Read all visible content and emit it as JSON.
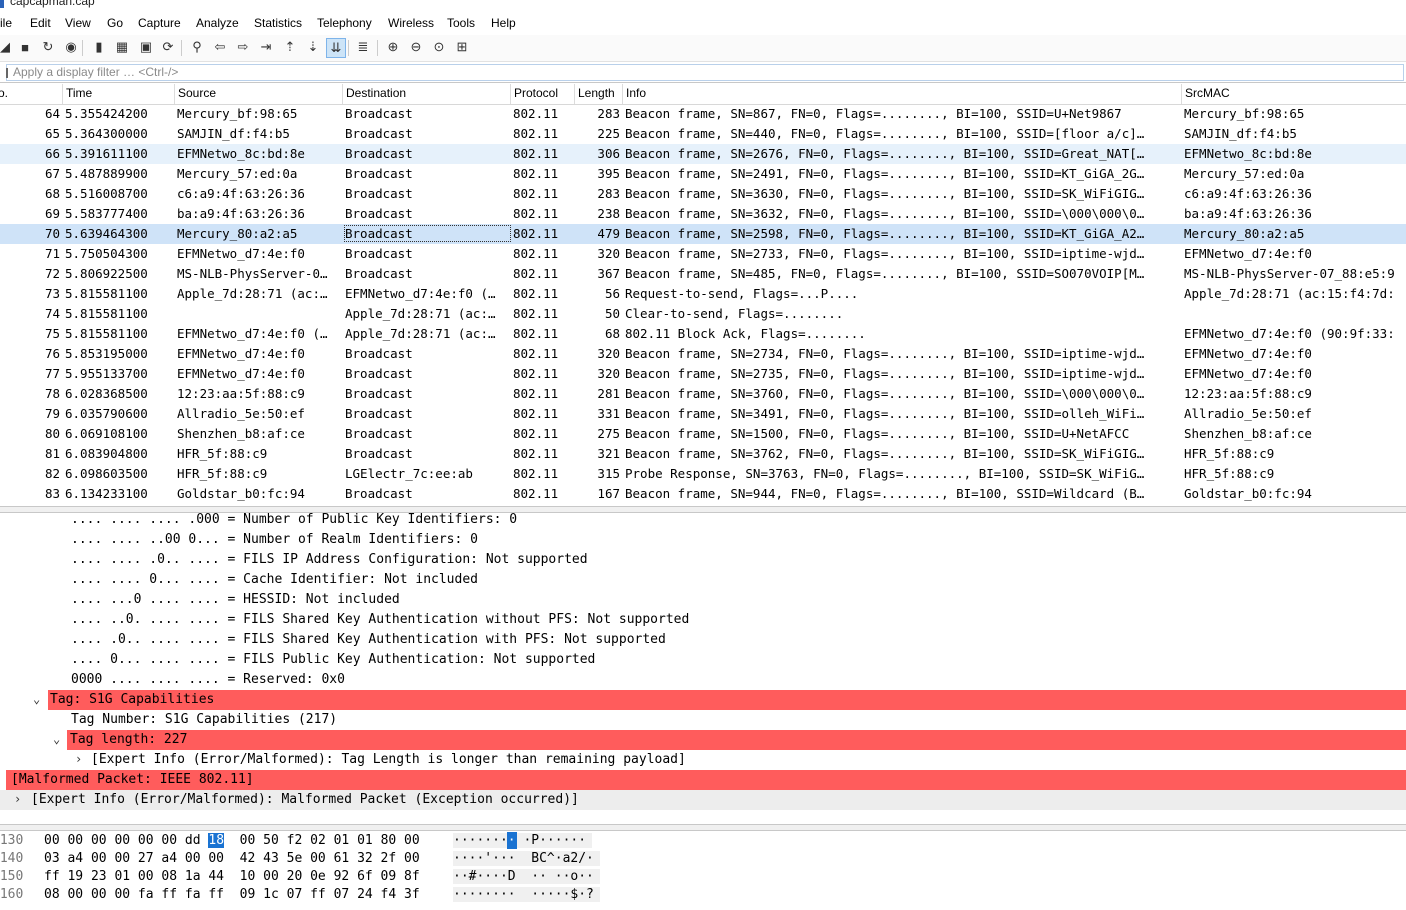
{
  "window": {
    "title": "capcapman.cap"
  },
  "menu": [
    "ile",
    "Edit",
    "View",
    "Go",
    "Capture",
    "Analyze",
    "Statistics",
    "Telephony",
    "Wireless",
    "Tools",
    "Help"
  ],
  "toolbar_icons": [
    "shark-fin-icon",
    "stop-icon",
    "restart-icon",
    "options-icon",
    "open-file-icon",
    "save-icon",
    "close-file-icon",
    "reload-icon",
    "find-icon",
    "back-icon",
    "forward-icon",
    "goto-packet-icon",
    "first-packet-icon",
    "last-packet-icon",
    "autoscroll-icon",
    "colorize-icon",
    "zoom-in-icon",
    "zoom-out-icon",
    "normal-size-icon",
    "resize-columns-icon"
  ],
  "filter": {
    "placeholder": "Apply a display filter … <Ctrl-/>"
  },
  "columns": [
    "o.",
    "Time",
    "Source",
    "Destination",
    "Protocol",
    "Length",
    "Info",
    "SrcMAC"
  ],
  "packets": [
    {
      "no": "64",
      "time": "5.355424200",
      "src": "Mercury_bf:98:65",
      "dst": "Broadcast",
      "proto": "802.11",
      "len": "283",
      "info": "Beacon frame, SN=867, FN=0, Flags=........, BI=100, SSID=U+Net9867",
      "srcmac": "Mercury_bf:98:65"
    },
    {
      "no": "65",
      "time": "5.364300000",
      "src": "SAMJIN_df:f4:b5",
      "dst": "Broadcast",
      "proto": "802.11",
      "len": "225",
      "info": "Beacon frame, SN=440, FN=0, Flags=........, BI=100, SSID=[floor a/c]…",
      "srcmac": "SAMJIN_df:f4:b5"
    },
    {
      "no": "66",
      "time": "5.391611100",
      "src": "EFMNetwo_8c:bd:8e",
      "dst": "Broadcast",
      "proto": "802.11",
      "len": "306",
      "info": "Beacon frame, SN=2676, FN=0, Flags=........, BI=100, SSID=Great_NAT[…",
      "srcmac": "EFMNetwo_8c:bd:8e"
    },
    {
      "no": "67",
      "time": "5.487889900",
      "src": "Mercury_57:ed:0a",
      "dst": "Broadcast",
      "proto": "802.11",
      "len": "395",
      "info": "Beacon frame, SN=2491, FN=0, Flags=........, BI=100, SSID=KT_GiGA_2G…",
      "srcmac": "Mercury_57:ed:0a"
    },
    {
      "no": "68",
      "time": "5.516008700",
      "src": "c6:a9:4f:63:26:36",
      "dst": "Broadcast",
      "proto": "802.11",
      "len": "283",
      "info": "Beacon frame, SN=3630, FN=0, Flags=........, BI=100, SSID=SK_WiFiGIG…",
      "srcmac": "c6:a9:4f:63:26:36"
    },
    {
      "no": "69",
      "time": "5.583777400",
      "src": "ba:a9:4f:63:26:36",
      "dst": "Broadcast",
      "proto": "802.11",
      "len": "238",
      "info": "Beacon frame, SN=3632, FN=0, Flags=........, BI=100, SSID=\\000\\000\\0…",
      "srcmac": "ba:a9:4f:63:26:36"
    },
    {
      "no": "70",
      "time": "5.639464300",
      "src": "Mercury_80:a2:a5",
      "dst": "Broadcast",
      "proto": "802.11",
      "len": "479",
      "info": "Beacon frame, SN=2598, FN=0, Flags=........, BI=100, SSID=KT_GiGA_A2…",
      "srcmac": "Mercury_80:a2:a5"
    },
    {
      "no": "71",
      "time": "5.750504300",
      "src": "EFMNetwo_d7:4e:f0",
      "dst": "Broadcast",
      "proto": "802.11",
      "len": "320",
      "info": "Beacon frame, SN=2733, FN=0, Flags=........, BI=100, SSID=iptime-wjd…",
      "srcmac": "EFMNetwo_d7:4e:f0"
    },
    {
      "no": "72",
      "time": "5.806922500",
      "src": "MS-NLB-PhysServer-0…",
      "dst": "Broadcast",
      "proto": "802.11",
      "len": "367",
      "info": "Beacon frame, SN=485, FN=0, Flags=........, BI=100, SSID=SO070VOIP[M…",
      "srcmac": "MS-NLB-PhysServer-07_88:e5:9"
    },
    {
      "no": "73",
      "time": "5.815581100",
      "src": "Apple_7d:28:71 (ac:…",
      "dst": "EFMNetwo_d7:4e:f0 (…",
      "proto": "802.11",
      "len": "56",
      "info": "Request-to-send, Flags=...P....",
      "srcmac": "Apple_7d:28:71 (ac:15:f4:7d:"
    },
    {
      "no": "74",
      "time": "5.815581100",
      "src": "",
      "dst": "Apple_7d:28:71 (ac:…",
      "proto": "802.11",
      "len": "50",
      "info": "Clear-to-send, Flags=........",
      "srcmac": ""
    },
    {
      "no": "75",
      "time": "5.815581100",
      "src": "EFMNetwo_d7:4e:f0 (…",
      "dst": "Apple_7d:28:71 (ac:…",
      "proto": "802.11",
      "len": "68",
      "info": "802.11 Block Ack, Flags=........",
      "srcmac": "EFMNetwo_d7:4e:f0 (90:9f:33:"
    },
    {
      "no": "76",
      "time": "5.853195000",
      "src": "EFMNetwo_d7:4e:f0",
      "dst": "Broadcast",
      "proto": "802.11",
      "len": "320",
      "info": "Beacon frame, SN=2734, FN=0, Flags=........, BI=100, SSID=iptime-wjd…",
      "srcmac": "EFMNetwo_d7:4e:f0"
    },
    {
      "no": "77",
      "time": "5.955133700",
      "src": "EFMNetwo_d7:4e:f0",
      "dst": "Broadcast",
      "proto": "802.11",
      "len": "320",
      "info": "Beacon frame, SN=2735, FN=0, Flags=........, BI=100, SSID=iptime-wjd…",
      "srcmac": "EFMNetwo_d7:4e:f0"
    },
    {
      "no": "78",
      "time": "6.028368500",
      "src": "12:23:aa:5f:88:c9",
      "dst": "Broadcast",
      "proto": "802.11",
      "len": "281",
      "info": "Beacon frame, SN=3760, FN=0, Flags=........, BI=100, SSID=\\000\\000\\0…",
      "srcmac": "12:23:aa:5f:88:c9"
    },
    {
      "no": "79",
      "time": "6.035790600",
      "src": "Allradio_5e:50:ef",
      "dst": "Broadcast",
      "proto": "802.11",
      "len": "331",
      "info": "Beacon frame, SN=3491, FN=0, Flags=........, BI=100, SSID=olleh_WiFi…",
      "srcmac": "Allradio_5e:50:ef"
    },
    {
      "no": "80",
      "time": "6.069108100",
      "src": "Shenzhen_b8:af:ce",
      "dst": "Broadcast",
      "proto": "802.11",
      "len": "275",
      "info": "Beacon frame, SN=1500, FN=0, Flags=........, BI=100, SSID=U+NetAFCC",
      "srcmac": "Shenzhen_b8:af:ce"
    },
    {
      "no": "81",
      "time": "6.083904800",
      "src": "HFR_5f:88:c9",
      "dst": "Broadcast",
      "proto": "802.11",
      "len": "321",
      "info": "Beacon frame, SN=3762, FN=0, Flags=........, BI=100, SSID=SK_WiFiGIG…",
      "srcmac": "HFR_5f:88:c9"
    },
    {
      "no": "82",
      "time": "6.098603500",
      "src": "HFR_5f:88:c9",
      "dst": "LGElectr_7c:ee:ab",
      "proto": "802.11",
      "len": "315",
      "info": "Probe Response, SN=3763, FN=0, Flags=........, BI=100, SSID=SK_WiFiG…",
      "srcmac": "HFR_5f:88:c9"
    },
    {
      "no": "83",
      "time": "6.134233100",
      "src": "Goldstar_b0:fc:94",
      "dst": "Broadcast",
      "proto": "802.11",
      "len": "167",
      "info": "Beacon frame, SN=944, FN=0, Flags=........, BI=100, SSID=Wildcard (B…",
      "srcmac": "Goldstar_b0:fc:94"
    }
  ],
  "details": [
    {
      "text": ".... .... .... .000 = Number of Public Key Identifiers: 0"
    },
    {
      "text": ".... .... ..00 0... = Number of Realm Identifiers: 0"
    },
    {
      "text": ".... .... .0.. .... = FILS IP Address Configuration: Not supported"
    },
    {
      "text": ".... .... 0... .... = Cache Identifier: Not included"
    },
    {
      "text": ".... ...0 .... .... = HESSID: Not included"
    },
    {
      "text": ".... ..0. .... .... = FILS Shared Key Authentication without PFS: Not supported"
    },
    {
      "text": ".... .0.. .... .... = FILS Shared Key Authentication with PFS: Not supported"
    },
    {
      "text": ".... 0... .... .... = FILS Public Key Authentication: Not supported"
    },
    {
      "text": "0000 .... .... .... = Reserved: 0x0"
    },
    {
      "text": "Tag: S1G Capabilities"
    },
    {
      "text": "Tag Number: S1G Capabilities (217)"
    },
    {
      "text": "Tag length: 227"
    },
    {
      "text": "[Expert Info (Error/Malformed): Tag Length is longer than remaining payload]"
    },
    {
      "text": "[Malformed Packet: IEEE 802.11]"
    },
    {
      "text": "[Expert Info (Error/Malformed): Malformed Packet (Exception occurred)]"
    }
  ],
  "hex": [
    {
      "off": "0130",
      "pre": "00 00 00 00 00 00 dd ",
      "hl": "18",
      "post": "  00 50 f2 02 01 01 80 00",
      "apre": "·······",
      "ahl": "·",
      "apost": " ·P······"
    },
    {
      "off": "0140",
      "pre": "03 a4 00 00 27 a4 00 00  42 43 5e 00 61 32 2f 00",
      "hl": "",
      "post": "",
      "apre": "····'···  BC^·a2/·",
      "ahl": "",
      "apost": ""
    },
    {
      "off": "0150",
      "pre": "ff 19 23 01 00 08 1a 44  10 00 20 0e 92 6f 09 8f",
      "hl": "",
      "post": "",
      "apre": "··#····D  ·· ··o··",
      "ahl": "",
      "apost": ""
    },
    {
      "off": "0160",
      "pre": "08 00 00 00 fa ff fa ff  09 1c 07 ff 07 24 f4 3f",
      "hl": "",
      "post": "",
      "apre": "········  ·····$·?",
      "ahl": "",
      "apost": ""
    }
  ],
  "colors": {
    "error": "#ff5c5c",
    "selected_row": "#cfe3f8",
    "alt_row": "#e6f1fb",
    "hex_highlight": "#1a73d2"
  }
}
